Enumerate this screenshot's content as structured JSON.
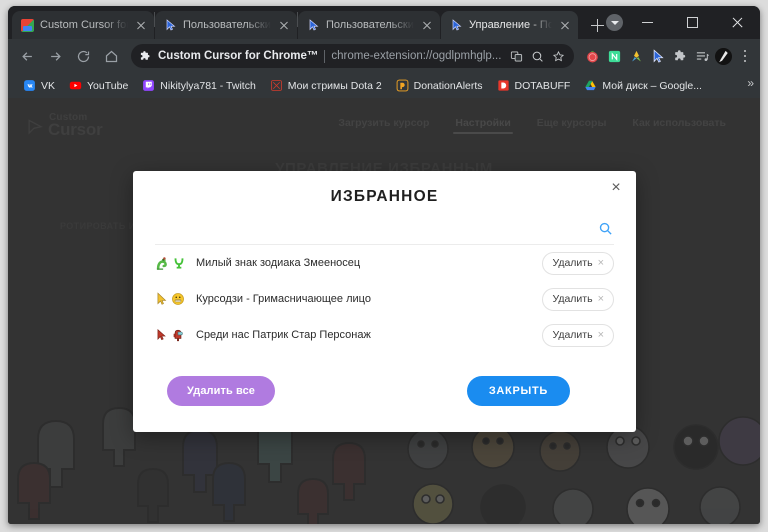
{
  "window": {
    "minimize_label": "Minimize",
    "maximize_label": "Maximize",
    "close_label": "Close",
    "tab_search_label": "Search tabs",
    "new_tab_label": "New tab"
  },
  "tabs": [
    {
      "title": "Custom Cursor for C",
      "favicon": "chrome-web-store-icon",
      "active": false
    },
    {
      "title": "Пользовательский",
      "favicon": "custom-cursor-icon",
      "active": false
    },
    {
      "title": "Пользовательский",
      "favicon": "custom-cursor-icon",
      "active": false
    },
    {
      "title": "Управление - Поль",
      "favicon": "custom-cursor-icon",
      "active": true
    }
  ],
  "toolbar": {
    "back_label": "Back",
    "forward_label": "Forward",
    "reload_label": "Reload",
    "home_label": "Home",
    "site_name": "Custom Cursor for Chrome™",
    "url": "chrome-extension://ogdlpmhglp...",
    "translate_label": "Translate",
    "zoom_label": "Zoom",
    "bookmark_label": "Bookmark this tab",
    "extensions_label": "Extensions",
    "profile_label": "Profile",
    "menu_label": "Customize and control Google Chrome",
    "ext_icons": [
      "tomato-timer-icon",
      "notion-icon",
      "color-picker-icon",
      "custom-cursor-icon",
      "puzzle-extensions-icon",
      "playlist-icon"
    ]
  },
  "bookmarks": {
    "items": [
      {
        "label": "VK",
        "icon": "vk-icon",
        "color": "#2787f5"
      },
      {
        "label": "YouTube",
        "icon": "youtube-icon",
        "color": "#ff0000"
      },
      {
        "label": "Nikitylya781 - Twitch",
        "icon": "twitch-icon",
        "color": "#9146ff"
      },
      {
        "label": "Мои стримы Dota 2",
        "icon": "dota-icon",
        "color": "#cf3b2d"
      },
      {
        "label": "DonationAlerts",
        "icon": "donationalerts-icon",
        "color": "#f5a623"
      },
      {
        "label": "DOTABUFF",
        "icon": "dotabuff-icon",
        "color": "#e8372b"
      },
      {
        "label": "Мой диск – Google...",
        "icon": "google-drive-icon",
        "color": "#4285f4"
      }
    ],
    "overflow_label": "»"
  },
  "site": {
    "logo_line1": "Custom",
    "logo_line2": "Cursor",
    "nav": [
      {
        "label": "Загрузить курсор",
        "active": false
      },
      {
        "label": "Настройки",
        "active": true
      },
      {
        "label": "Еще курсоры",
        "active": false
      },
      {
        "label": "Как использовать",
        "active": false
      }
    ],
    "page_title": "УПРАВЛЕНИЕ ИЗБРАННЫМ",
    "page_subtext": "РОТИРОВАТЬ ИЗ"
  },
  "modal": {
    "title": "ИЗБРАННОЕ",
    "close_label": "×",
    "search_icon": "search-icon",
    "items": [
      {
        "name": "Милый знак зодиака Змееносец",
        "delete_label": "Удалить",
        "delete_x": "×",
        "icon": "green-snake-cursor-icon"
      },
      {
        "name": "Курсодзи - Гримасничающее лицо",
        "delete_label": "Удалить",
        "delete_x": "×",
        "icon": "yellow-grimace-cursor-icon"
      },
      {
        "name": "Среди нас Патрик Стар Персонаж",
        "delete_label": "Удалить",
        "delete_x": "×",
        "icon": "red-amongus-cursor-icon"
      }
    ],
    "delete_all_label": "Удалить все",
    "close_button_label": "ЗАКРЫТЬ"
  },
  "colors": {
    "accent_blue": "#1a8cf0",
    "accent_purple": "#b07be0",
    "search_blue": "#3fa2f7",
    "page_bg": "#333333",
    "chrome_bg": "#323639",
    "tabstrip_bg": "#202124"
  }
}
